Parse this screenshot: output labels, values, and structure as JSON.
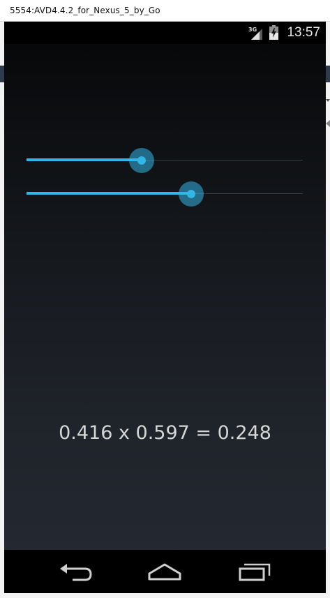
{
  "window": {
    "title": "5554:AVD4.4.2_for_Nexus_5_by_Go"
  },
  "status_bar": {
    "network_label": "3G",
    "time": "13:57",
    "icons": [
      "signal-icon",
      "battery-icon"
    ]
  },
  "seekbars": [
    {
      "name": "seekbar-a",
      "value": 0.416
    },
    {
      "name": "seekbar-b",
      "value": 0.597
    }
  ],
  "result": {
    "text": "0.416 x 0.597 = 0.248"
  },
  "nav_bar": {
    "buttons": [
      "back-icon",
      "home-icon",
      "recents-icon"
    ]
  },
  "colors": {
    "accent": "#33b5e5",
    "text": "#d6d6d6",
    "background_top": "#050607",
    "background_bottom": "#252a33"
  }
}
